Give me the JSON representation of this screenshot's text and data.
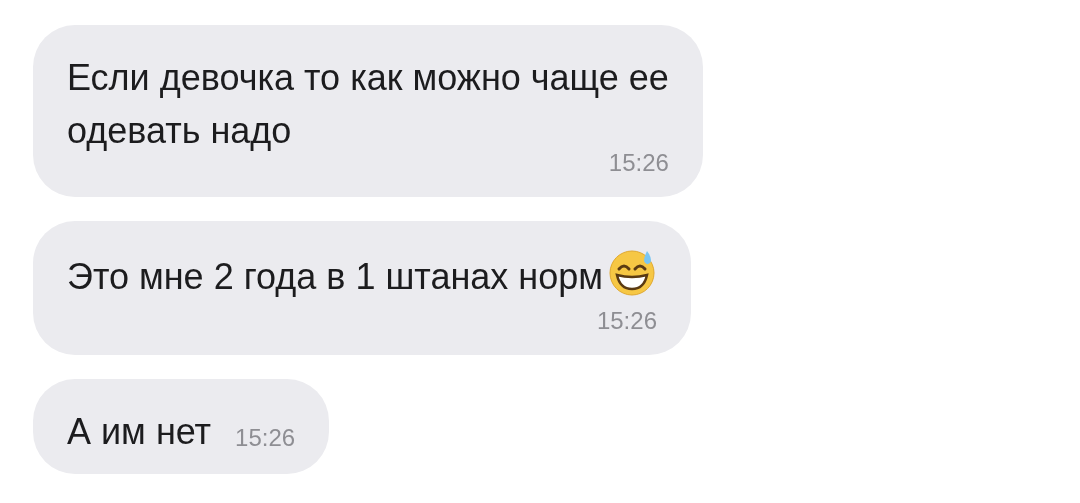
{
  "messages": [
    {
      "kind": "overlap",
      "lines": [
        "Если девочка то как можно чаще ее",
        "одевать надо"
      ],
      "time": "15:26",
      "emoji": false
    },
    {
      "kind": "below",
      "lines": [
        "Это мне 2 года в 1 штанах норм"
      ],
      "time": "15:26",
      "emoji": true
    },
    {
      "kind": "inline",
      "lines": [
        "А им нет"
      ],
      "time": "15:26",
      "emoji": false
    }
  ]
}
